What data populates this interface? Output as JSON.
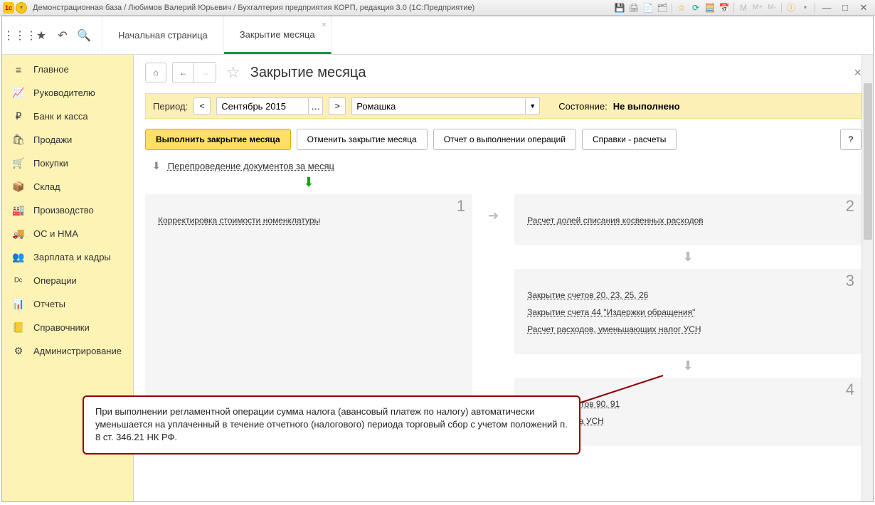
{
  "titlebar": {
    "title": "Демонстрационная база / Любимов Валерий Юрьевич / Бухгалтерия предприятия КОРП, редакция 3.0  (1С:Предприятие)"
  },
  "tabs": {
    "start": "Начальная страница",
    "active": "Закрытие месяца"
  },
  "sidebar": {
    "items": [
      {
        "icon": "≡",
        "label": "Главное"
      },
      {
        "icon": "📈",
        "label": "Руководителю"
      },
      {
        "icon": "₽",
        "label": "Банк и касса"
      },
      {
        "icon": "🛍",
        "label": "Продажи"
      },
      {
        "icon": "🛒",
        "label": "Покупки"
      },
      {
        "icon": "📦",
        "label": "Склад"
      },
      {
        "icon": "🏭",
        "label": "Производство"
      },
      {
        "icon": "🚚",
        "label": "ОС и НМА"
      },
      {
        "icon": "👥",
        "label": "Зарплата и кадры"
      },
      {
        "icon": "ᴰᶜ",
        "label": "Операции"
      },
      {
        "icon": "📊",
        "label": "Отчеты"
      },
      {
        "icon": "📒",
        "label": "Справочники"
      },
      {
        "icon": "⚙",
        "label": "Администрирование"
      }
    ]
  },
  "page": {
    "title": "Закрытие месяца"
  },
  "period": {
    "label": "Период:",
    "value": "Сентябрь 2015",
    "org": "Ромашка",
    "status_label": "Состояние:",
    "status_value": "Не выполнено"
  },
  "actions": {
    "execute": "Выполнить закрытие месяца",
    "cancel": "Отменить закрытие месяца",
    "report": "Отчет о выполнении операций",
    "refs": "Справки - расчеты",
    "help": "?"
  },
  "repost": {
    "label": "Перепроведение документов за месяц"
  },
  "steps": {
    "s1": {
      "num": "1",
      "links": [
        "Корректировка стоимости номенклатуры"
      ]
    },
    "s2": {
      "num": "2",
      "links": [
        "Расчет долей списания косвенных расходов"
      ]
    },
    "s3": {
      "num": "3",
      "links": [
        "Закрытие счетов 20, 23, 25, 26",
        "Закрытие счета 44 \"Издержки обращения\"",
        "Расчет расходов, уменьшающих налог УСН"
      ]
    },
    "s4": {
      "num": "4",
      "links": [
        "Закрытие счетов 90, 91",
        "Расчет налога УСН"
      ]
    }
  },
  "callout": {
    "text": "При выполнении регламентной операции сумма налога (авансовый платеж по налогу) автоматически уменьшается на уплаченный в течение отчетного (налогового) периода торговый сбор с учетом положений п. 8 ст. 346.21 НК РФ."
  }
}
